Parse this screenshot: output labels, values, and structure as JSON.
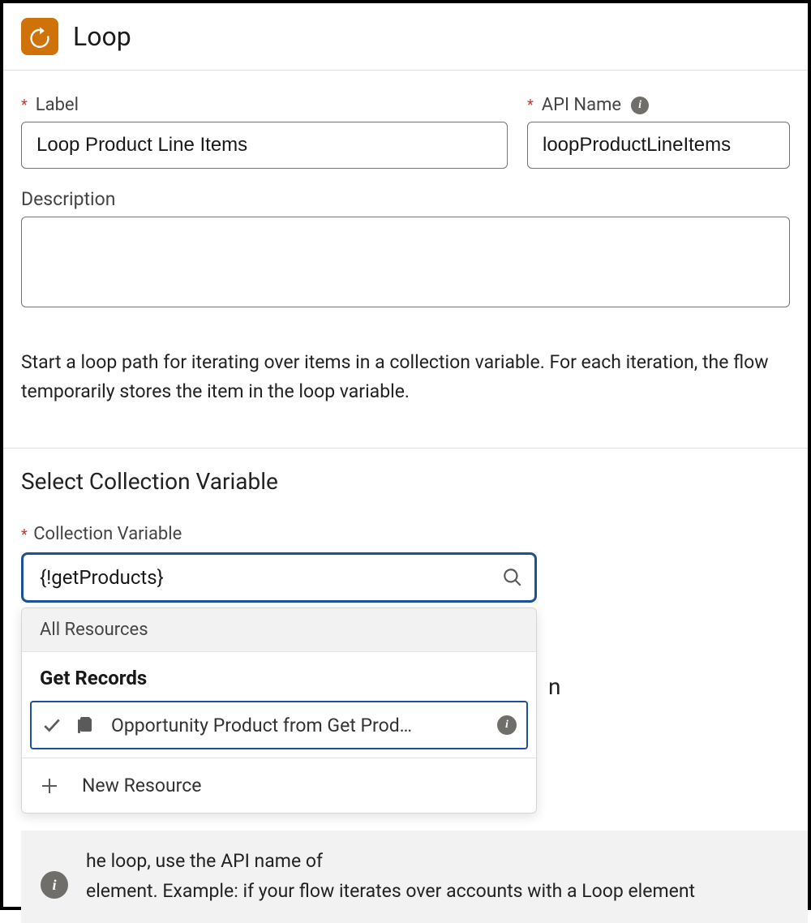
{
  "header": {
    "title": "Loop"
  },
  "fields": {
    "label_caption": "Label",
    "label_value": "Loop Product Line Items",
    "apiname_caption": "API Name",
    "apiname_value": "loopProductLineItems",
    "description_caption": "Description",
    "description_value": ""
  },
  "help": {
    "intro": "Start a loop path for iterating over items in a collection variable. For each iteration, the flow temporarily stores the item in the loop variable."
  },
  "section": {
    "title": "Select Collection Variable",
    "cv_caption": "Collection Variable",
    "cv_value": "{!getProducts}"
  },
  "dropdown": {
    "all_resources": "All Resources",
    "group_title": "Get Records",
    "item_text": "Opportunity Product from Get Prod…",
    "new_resource": "New Resource"
  },
  "behind": {
    "letter": "n"
  },
  "bottom": {
    "line1": "he loop, use the API name of",
    "line2": "element. Example: if your flow iterates over accounts with a Loop element"
  }
}
